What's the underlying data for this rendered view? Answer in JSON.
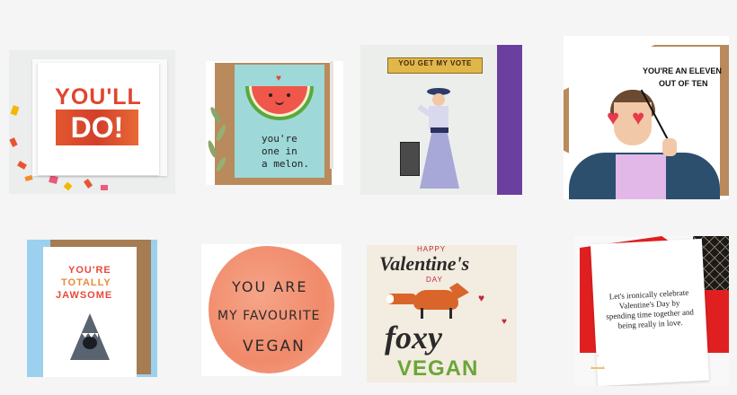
{
  "gallery": {
    "cards": [
      {
        "text_line1": "YOU'LL",
        "text_line2": "DO!",
        "accent": "#e0452f"
      },
      {
        "text_lines": [
          "you're",
          "one in",
          "a melon."
        ],
        "accent": "#9ed8d8"
      },
      {
        "banner": "YOU GET MY VOTE",
        "accent": "#6b3fa0"
      },
      {
        "text_line1": "YOU'RE AN ELEVEN",
        "text_line2": "OUT OF TEN",
        "accent": "#e83a4a"
      },
      {
        "text_lines": [
          "YOU'RE",
          "TOTALLY",
          "JAWSOME"
        ],
        "accent": "#e8a25a"
      },
      {
        "text_lines": [
          "YOU ARE",
          "MY FAVOURITE",
          "VEGAN"
        ],
        "accent": "#f08a6a"
      },
      {
        "happy": "HAPPY",
        "valentines": "Valentine's",
        "day": "DAY",
        "foxy": "foxy",
        "vegan": "VEGAN",
        "accent": "#3a3a3a"
      },
      {
        "text": "Let's ironically celebrate Valentine's Day by spending time together and being really in love.",
        "accent": "#e02020"
      }
    ]
  }
}
